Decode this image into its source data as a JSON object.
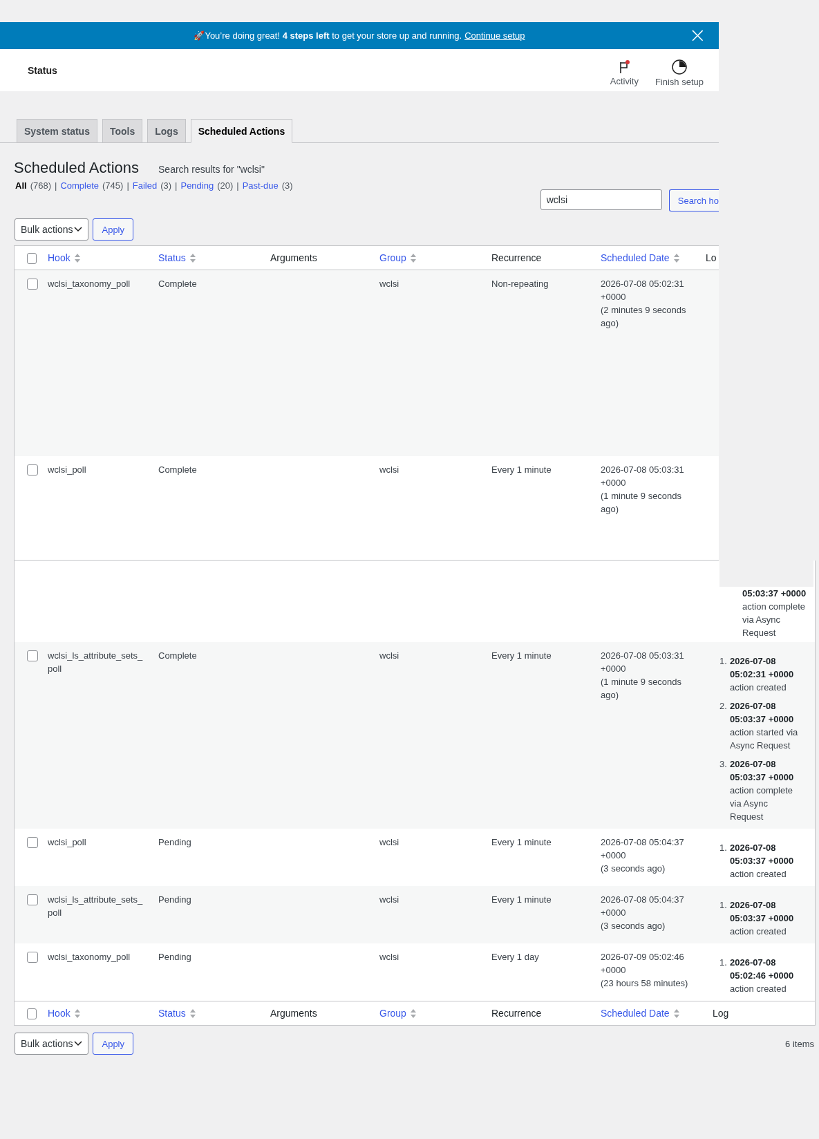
{
  "banner": {
    "text": "🚀You’re doing great! **4 steps left** to get your store up and running.",
    "link": "Continue setup",
    "close": "×"
  },
  "header": {
    "title": "Status",
    "actions": [
      {
        "kind": "activity",
        "label": "Activity",
        "unread": true
      },
      {
        "kind": "setup",
        "label": "Finish setup"
      }
    ]
  },
  "tabs": [
    {
      "label": "System status",
      "selected": false
    },
    {
      "label": "Tools",
      "selected": false
    },
    {
      "label": "Logs",
      "selected": false
    },
    {
      "label": "Scheduled Actions",
      "selected": true
    }
  ],
  "page": {
    "title": "Scheduled Actions",
    "subtitle": "Search results for \"wclsi\""
  },
  "filters": [
    {
      "label": "All",
      "count": "(768)",
      "selected": true,
      "separator": "|"
    },
    {
      "label": "Complete",
      "count": "(745)",
      "selected": false,
      "separator": "|"
    },
    {
      "label": "Failed",
      "count": "(3)",
      "selected": false,
      "separator": "|"
    },
    {
      "label": "Pending",
      "count": "(20)",
      "selected": false,
      "separator": "|"
    },
    {
      "label": "Past-due",
      "count": "(3)",
      "selected": false
    }
  ],
  "search": {
    "value": "wclsi",
    "button": "Search ho"
  },
  "bulk_top": {
    "select": "Bulk actions",
    "apply": "Apply"
  },
  "table": {
    "select_all_checked": false,
    "columns": [
      {
        "label": "Hook",
        "sortable": true
      },
      {
        "label": "Status",
        "sortable": true
      },
      {
        "label": "Arguments",
        "sortable": false
      },
      {
        "label": "Group",
        "sortable": true
      },
      {
        "label": "Recurrence",
        "sortable": false
      },
      {
        "label": "Scheduled Date",
        "sortable": true
      },
      {
        "label": "Lo",
        "sortable": false
      }
    ],
    "rows_before_seam": [
      {
        "checked": false,
        "hook": "wclsi_taxonomy_poll",
        "status": "Complete",
        "group": "wclsi",
        "recurrence": "Non-repeating",
        "date": "2026-07-08 05:02:31 +0000",
        "relative": "(2 minutes 9 seconds ago)"
      },
      {
        "checked": false,
        "hook": "wclsi_poll",
        "status": "Complete",
        "group": "wclsi",
        "recurrence": "Every 1 minute",
        "date": "2026-07-08 05:03:31 +0000",
        "relative": "(1 minute 9 seconds ago)"
      }
    ],
    "seam_fragment": {
      "time": "05:03:37 +0000",
      "text": "action complete via Async Request"
    },
    "rows_after_seam": [
      {
        "checked": false,
        "hook": "wclsi_ls_attribute_sets_poll",
        "status": "Complete",
        "group": "wclsi",
        "recurrence": "Every 1 minute",
        "date": "2026-07-08 05:03:31 +0000",
        "relative": "(1 minute 9 seconds ago)",
        "log": [
          {
            "number": "1.",
            "time": "2026-07-08 05:02:31 +0000",
            "text": "action created"
          },
          {
            "number": "2.",
            "time": "2026-07-08 05:03:37 +0000",
            "text": "action started via Async Request"
          },
          {
            "number": "3.",
            "time": "2026-07-08 05:03:37 +0000",
            "text": "action complete via Async Request"
          }
        ]
      },
      {
        "checked": false,
        "hook": "wclsi_poll",
        "status": "Pending",
        "group": "wclsi",
        "recurrence": "Every 1 minute",
        "date": "2026-07-08 05:04:37 +0000",
        "relative": "(3 seconds ago)",
        "log": [
          {
            "number": "1.",
            "time": "2026-07-08 05:03:37 +0000",
            "text": "action created"
          }
        ]
      },
      {
        "checked": false,
        "hook": "wclsi_ls_attribute_sets_poll",
        "status": "Pending",
        "group": "wclsi",
        "recurrence": "Every 1 minute",
        "date": "2026-07-08 05:04:37 +0000",
        "relative": "(3 seconds ago)",
        "log": [
          {
            "number": "1.",
            "time": "2026-07-08 05:03:37 +0000",
            "text": "action created"
          }
        ]
      },
      {
        "checked": false,
        "hook": "wclsi_taxonomy_poll",
        "status": "Pending",
        "group": "wclsi",
        "recurrence": "Every 1 day",
        "date": "2026-07-09 05:02:46 +0000",
        "relative": "(23 hours 58 minutes)",
        "log": [
          {
            "number": "1.",
            "time": "2026-07-08 05:02:46 +0000",
            "text": "action created"
          }
        ]
      }
    ],
    "footer_select_all_checked": false,
    "footer_columns": [
      {
        "label": "Hook",
        "sortable": true
      },
      {
        "label": "Status",
        "sortable": true
      },
      {
        "label": "Arguments",
        "sortable": false
      },
      {
        "label": "Group",
        "sortable": true
      },
      {
        "label": "Recurrence",
        "sortable": false
      },
      {
        "label": "Scheduled Date",
        "sortable": true
      },
      {
        "label": "Log",
        "sortable": false
      }
    ]
  },
  "bulk_bottom": {
    "select": "Bulk actions",
    "apply": "Apply",
    "count": "6 items"
  }
}
